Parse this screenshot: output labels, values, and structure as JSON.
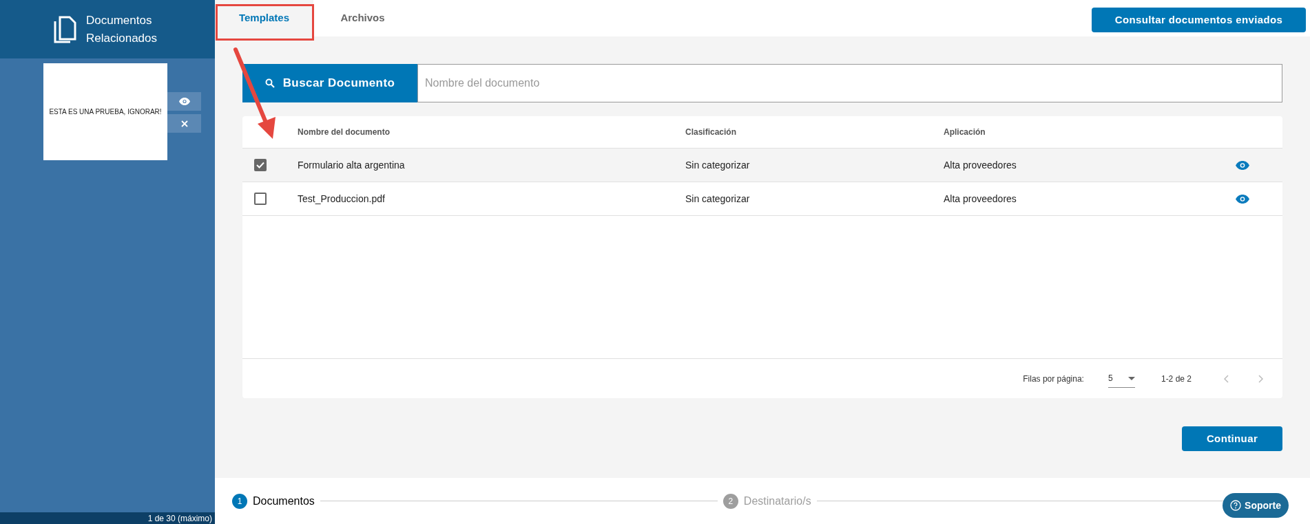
{
  "sidebar": {
    "title": "Documentos Relacionados",
    "attachments": [
      {
        "preview_text": "ESTA ES UNA PRUEBA, IGNORAR!"
      }
    ],
    "counter": "1 de 30 (máximo)"
  },
  "tabs": [
    {
      "label": "Templates",
      "selected": true
    },
    {
      "label": "Archivos",
      "selected": false
    }
  ],
  "header_button": "Consultar documentos enviados",
  "search": {
    "button": "Buscar Documento",
    "placeholder": "Nombre del documento"
  },
  "table": {
    "columns": [
      "Nombre del documento",
      "Clasificación",
      "Aplicación"
    ],
    "rows": [
      {
        "checked": true,
        "cells": [
          "Formulario alta argentina",
          "Sin categorizar",
          "Alta proveedores"
        ]
      },
      {
        "checked": false,
        "cells": [
          "Test_Produccion.pdf",
          "Sin categorizar",
          "Alta proveedores"
        ]
      }
    ]
  },
  "pagination": {
    "rows_per_page_label": "Filas por página:",
    "rows_per_page": "5",
    "range": "1-2 de 2"
  },
  "continue_button": "Continuar",
  "stepper": [
    {
      "number": "1",
      "label": "Documentos",
      "selected": true
    },
    {
      "number": "2",
      "label": "Destinatario/s",
      "selected": false
    }
  ],
  "support_button": "Soporte"
}
